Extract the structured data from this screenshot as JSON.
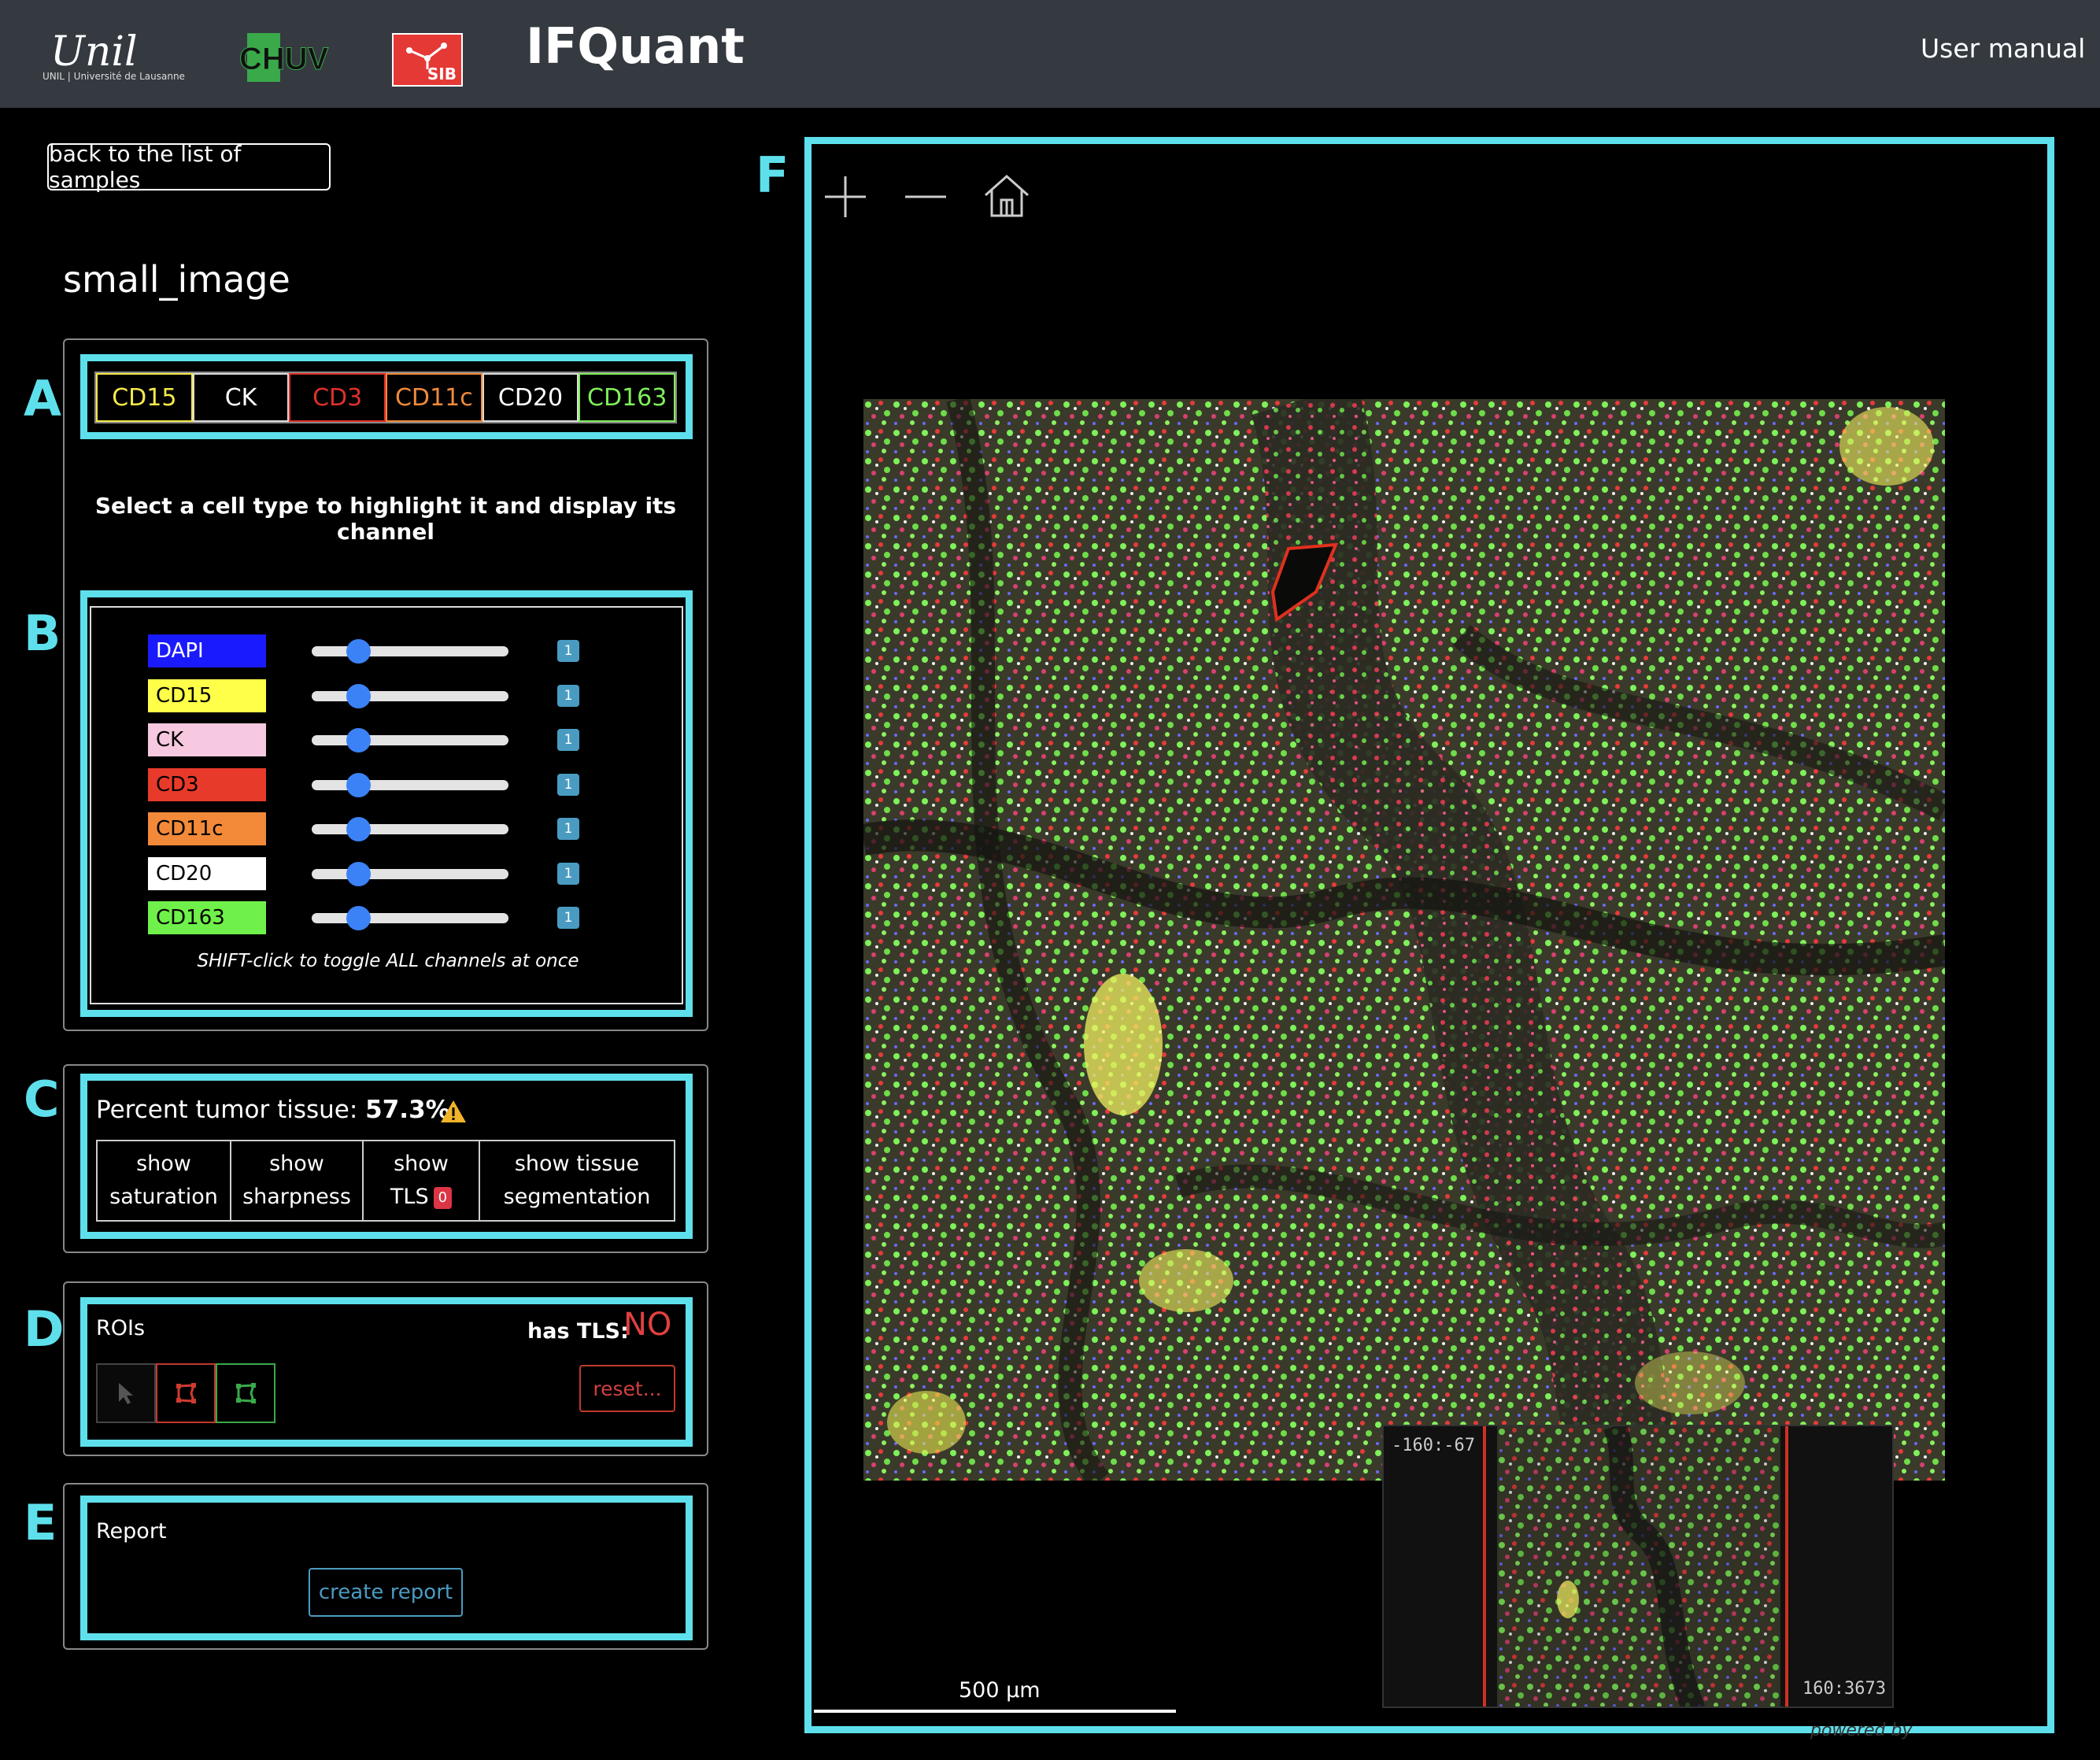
{
  "header": {
    "title": "IFQuant",
    "user_manual": "User manual",
    "logos": {
      "unil_script": "Unil",
      "unil_sub": "UNIL | Université de Lausanne",
      "chuv": "CHUV",
      "sib": "SIB"
    }
  },
  "sidebar": {
    "back_button": "back to the list of samples",
    "sample_name": "small_image"
  },
  "section_letters": {
    "a": "A",
    "b": "B",
    "c": "C",
    "d": "D",
    "e": "E",
    "f": "F"
  },
  "cell_types": [
    {
      "label": "CD15",
      "color": "#f5e94a"
    },
    {
      "label": "CK",
      "color": "#ffffff"
    },
    {
      "label": "CD3",
      "color": "#e0302a"
    },
    {
      "label": "CD11c",
      "color": "#f08a3a"
    },
    {
      "label": "CD20",
      "color": "#ffffff"
    },
    {
      "label": "CD163",
      "color": "#7ff05a"
    }
  ],
  "cell_type_hint": "Select a cell type to highlight it and display its channel",
  "channels": [
    {
      "label": "DAPI",
      "bg": "#1a1aff",
      "fg": "#ffffff",
      "value": "1"
    },
    {
      "label": "CD15",
      "bg": "#ffff4a",
      "fg": "#000000",
      "value": "1"
    },
    {
      "label": "CK",
      "bg": "#f6c9e0",
      "fg": "#000000",
      "value": "1"
    },
    {
      "label": "CD3",
      "bg": "#e83a2a",
      "fg": "#000000",
      "value": "1"
    },
    {
      "label": "CD11c",
      "bg": "#f28a3a",
      "fg": "#000000",
      "value": "1"
    },
    {
      "label": "CD20",
      "bg": "#ffffff",
      "fg": "#000000",
      "value": "1"
    },
    {
      "label": "CD163",
      "bg": "#6ff04a",
      "fg": "#000000",
      "value": "1"
    }
  ],
  "channel_hint": "SHIFT-click to toggle ALL channels at once",
  "tumor": {
    "label": "Percent tumor tissue:",
    "value": "57.3%",
    "buttons": [
      {
        "line1": "show",
        "line2": "saturation"
      },
      {
        "line1": "show",
        "line2": "sharpness"
      },
      {
        "line1": "show",
        "line2": "TLS",
        "badge": "0"
      },
      {
        "line1": "show tissue",
        "line2": "segmentation"
      }
    ]
  },
  "rois": {
    "label": "ROIs",
    "has_tls_label": "has TLS:",
    "has_tls_value": "NO",
    "reset": "reset..."
  },
  "report": {
    "label": "Report",
    "create": "create report"
  },
  "viewer": {
    "scale_label": "500 µm",
    "nav_coord_left": "-160:-67",
    "nav_coord_right": "160:3673",
    "powered_by": "powered by"
  },
  "colors": {
    "highlight": "#5ee0ec",
    "header_bg": "#343a40",
    "accent_blue": "#4a9bc1",
    "danger": "#dc3545"
  },
  "icons": [
    "warning-icon",
    "zoom-in-icon",
    "zoom-out-icon",
    "home-icon",
    "pointer-icon",
    "draw-region-red-icon",
    "draw-region-green-icon"
  ]
}
